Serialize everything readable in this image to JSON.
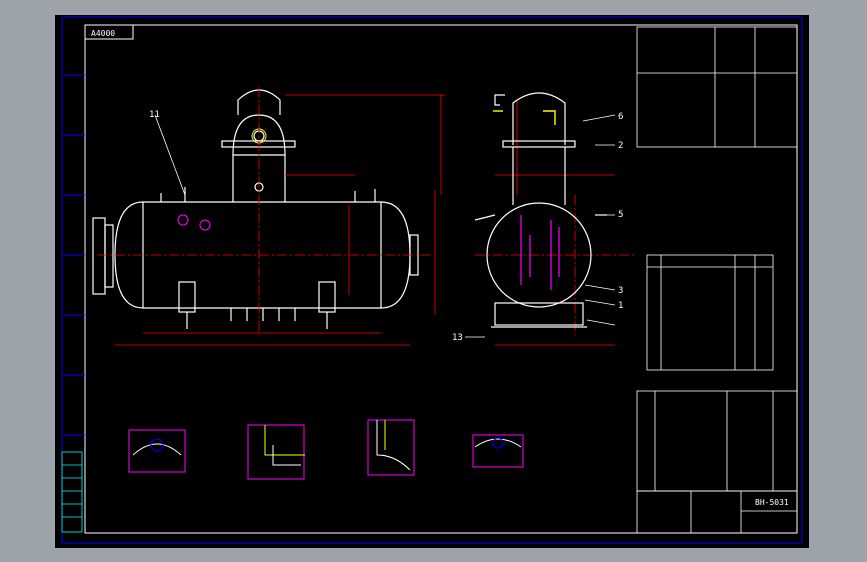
{
  "drawing": {
    "title_tab": "A4000",
    "part_labels": [
      "11",
      "6",
      "5",
      "2",
      "3",
      "1",
      "13"
    ],
    "title_block_code": "BH-5031"
  },
  "colors": {
    "background": "#000000",
    "app_chrome": "#9ca3ab",
    "frame": "#0000ff",
    "vessel": "#ffffff",
    "dimension": "#ff0000",
    "nozzle": "#ff00ff",
    "text": "#00ffff",
    "center_line": "#ff0000",
    "highlight": "#ffff00"
  }
}
